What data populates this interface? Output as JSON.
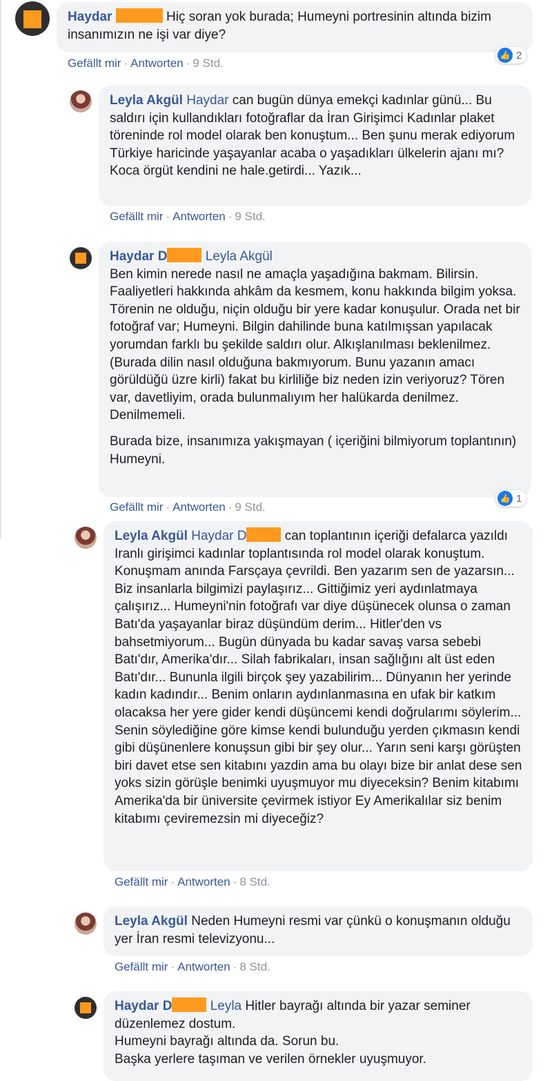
{
  "actions": {
    "like": "Gefällt mir",
    "reply": "Antworten",
    "sep": "·"
  },
  "comments": [
    {
      "author": "Haydar",
      "mention": "",
      "text": "Hiç soran yok burada; Humeyni portresinin altında bizim insanımızın ne işi var diye?",
      "time": "9 Std.",
      "reactions": "2"
    },
    {
      "author": "Leyla Akgül",
      "mention": "Haydar",
      "text": "can bugün dünya emekçi kadınlar günü... Bu saldırı için kullandıkları fotoğraflar da İran Girişimci Kadınlar plaket töreninde rol model olarak ben konuştum... Ben şunu merak ediyorum Türkiye haricinde yaşayanlar acaba o yaşadıkları ülkelerin ajanı mı? Koca örgüt kendini ne hale.getirdi... Yazık...",
      "time": "9 Std."
    },
    {
      "author": "Haydar D",
      "mention": "Leyla Akgül",
      "text": "Ben kimin nerede nasıl ne amaçla yaşadığına bakmam. Bilirsin. Faaliyetleri hakkında ahkâm da kesmem, konu hakkında bilgim yoksa.\nTörenin ne olduğu, niçin olduğu bir yere kadar konuşulur. Orada net bir fotoğraf var; Humeyni. Bilgin dahilinde buna katılmışsan yapılacak yorumdan farklı bu şekilde saldırı olur. Alkışlanılması beklenilmez. (Burada dilin nasıl olduğuna bakmıyorum. Bunu yazanın amacı görüldüğü üzre kirli) fakat bu kirliliğe biz neden izin veriyoruz? Tören var, davetliyim, orada bulunmalıyım her halükarda denilmez. Denilmemeli.",
      "text2": "Burada bize, insanımıza yakışmayan ( içeriğini bilmiyorum toplantının) Humeyni.",
      "time": "9 Std.",
      "reactions": "1"
    },
    {
      "author": "Leyla Akgül",
      "mention": "Haydar D",
      "text": "can toplantının içeriği defalarca yazıldı Iranlı girişimci kadınlar toplantısında rol model olarak konuştum. Konuşmam anında Farsçaya çevrildi. Ben yazarım sen de yazarsın... Biz insanlarla bilgimizi paylaşırız... Gittiğimiz yeri aydınlatmaya çalışırız... Humeyni'nin fotoğrafı var diye düşünecek olunsa o zaman Batı'da yaşayanlar biraz düşündüm derim... Hitler'den vs bahsetmiyorum... Bugün dünyada bu kadar savaş varsa sebebi Batı'dır, Amerika'dır... Silah fabrikaları, insan sağlığını alt üst eden Batı'dır... Bununla ilgili birçok şey yazabilirim... Dünyanın her yerinde kadın kadındır... Benim onların aydınlanmasına en ufak bir katkım olacaksa her yere gider kendi düşüncemi kendi doğrularımı söylerim... Senin söylediğine göre kimse kendi bulunduğu yerden çıkmasın kendi gibi düşünenlere konuşsun gibi bir şey olur... Yarın seni karşı görüşten biri davet etse sen kitabını yazdin ama bu olayı bize bir anlat dese sen yoks sizin görüşle benimki uyuşmuyor mu diyeceksin? Benim kitabımı Amerika'da bir üniversite çevirmek istiyor Ey Amerikalılar siz benim kitabımı çeviremezsin mi diyeceğiz?",
      "time": "8 Std."
    },
    {
      "author": "Leyla Akgül",
      "mention": "",
      "text": "Neden Humeyni resmi var çünkü o konuşmanın olduğu yer İran resmi televizyonu...",
      "time": "8 Std."
    },
    {
      "author": "Haydar D",
      "mention": "Leyla",
      "text": "Hitler bayrağı altında bir yazar seminer düzenlemez dostum.\nHumeyni bayrağı altında da. Sorun bu.\nBaşka yerlere taşıman ve verilen örnekler uyuşmuyor."
    }
  ]
}
